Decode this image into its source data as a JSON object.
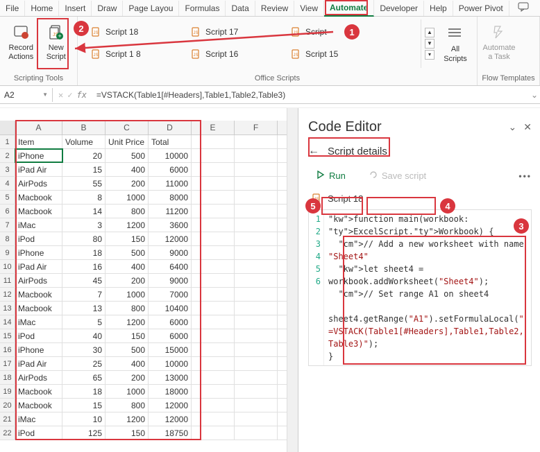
{
  "tabs": [
    "File",
    "Home",
    "Insert",
    "Draw",
    "Page Layou",
    "Formulas",
    "Data",
    "Review",
    "View",
    "Automate",
    "Developer",
    "Help",
    "Power Pivot"
  ],
  "active_tab": "Automate",
  "ribbon": {
    "record_actions": "Record\nActions",
    "new_script": "New\nScript",
    "all_scripts": "All\nScripts",
    "automate_task": "Automate\na Task",
    "groups": {
      "scripting": "Scripting Tools",
      "office": "Office Scripts",
      "flow": "Flow Templates"
    },
    "gallery": [
      {
        "name": "Script 18"
      },
      {
        "name": "Script 1 8"
      },
      {
        "name": "Script 17"
      },
      {
        "name": "Script 16"
      },
      {
        "name": "Script"
      },
      {
        "name": "Script 15"
      }
    ]
  },
  "namebox": "A2",
  "formula": "=VSTACK(Table1[#Headers],Table1,Table2,Table3)",
  "columns": [
    "A",
    "B",
    "C",
    "D",
    "E",
    "F"
  ],
  "headers": [
    "Item",
    "Volume",
    "Unit Price",
    "Total"
  ],
  "rows": [
    [
      "iPhone",
      20,
      500,
      10000
    ],
    [
      "iPad Air",
      15,
      400,
      6000
    ],
    [
      "AirPods",
      55,
      200,
      11000
    ],
    [
      "Macbook ",
      8,
      1000,
      8000
    ],
    [
      "Macbook ",
      14,
      800,
      11200
    ],
    [
      "iMac",
      3,
      1200,
      3600
    ],
    [
      "iPod",
      80,
      150,
      12000
    ],
    [
      "iPhone",
      18,
      500,
      9000
    ],
    [
      "iPad Air",
      16,
      400,
      6400
    ],
    [
      "AirPods",
      45,
      200,
      9000
    ],
    [
      "Macbook ",
      7,
      1000,
      7000
    ],
    [
      "Macbook ",
      13,
      800,
      10400
    ],
    [
      "iMac",
      5,
      1200,
      6000
    ],
    [
      "iPod",
      40,
      150,
      6000
    ],
    [
      "iPhone",
      30,
      500,
      15000
    ],
    [
      "iPad Air",
      25,
      400,
      10000
    ],
    [
      "AirPods",
      65,
      200,
      13000
    ],
    [
      "Macbook ",
      18,
      1000,
      18000
    ],
    [
      "Macbook ",
      15,
      800,
      12000
    ],
    [
      "iMac",
      10,
      1200,
      12000
    ],
    [
      "iPod",
      125,
      150,
      18750
    ]
  ],
  "editor": {
    "title": "Code Editor",
    "subtitle": "Script details",
    "run": "Run",
    "save": "Save script",
    "script_name": "Script 18",
    "code_lines": [
      "function main(workbook: ExcelScript.Workbook) {",
      "  // Add a new worksheet with name \"Sheet4\"",
      "  let sheet4 = workbook.addWorksheet(\"Sheet4\");",
      "  // Set range A1 on sheet4",
      "  sheet4.getRange(\"A1\").setFormulaLocal(\"=VSTACK(Table1[#Headers],Table1,Table2,Table3)\");",
      "}"
    ]
  },
  "markers": {
    "m1": "1",
    "m2": "2",
    "m3": "3",
    "m4": "4",
    "m5": "5"
  }
}
